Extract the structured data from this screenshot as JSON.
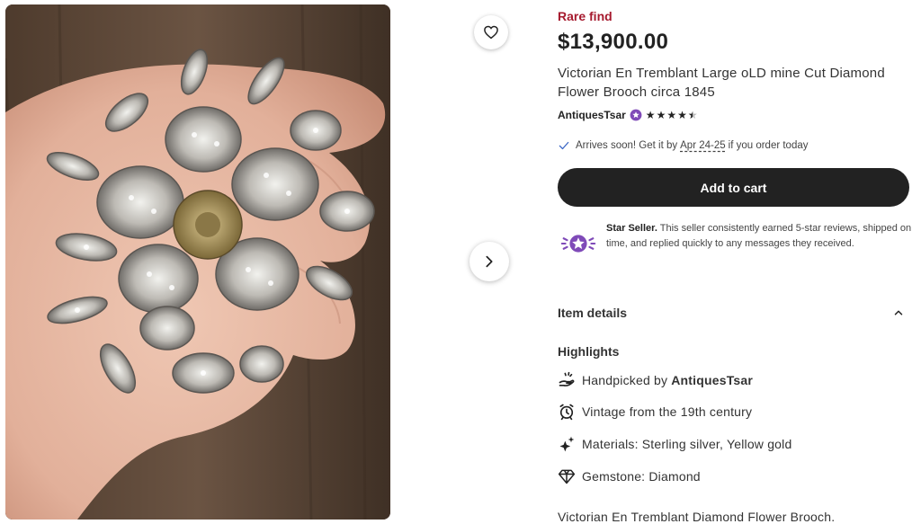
{
  "listing": {
    "rare_label": "Rare find",
    "price": "$13,900.00",
    "title": "Victorian En Tremblant Large oLD mine Cut Diamond Flower Brooch circa 1845",
    "seller": "AntiquesTsar",
    "rating": 4.5,
    "arrival": {
      "prefix": "Arrives soon! Get it by",
      "dates": "Apr 24-25",
      "suffix": "if you order today"
    },
    "add_to_cart": "Add to cart",
    "star_seller": {
      "title": "Star Seller.",
      "text": "This seller consistently earned 5-star reviews, shipped on time, and replied quickly to any messages they received."
    }
  },
  "details": {
    "header": "Item details",
    "highlights_title": "Highlights",
    "handpicked_prefix": "Handpicked by",
    "handpicked_name": "AntiquesTsar",
    "vintage": "Vintage from the 19th century",
    "materials": "Materials: Sterling silver, Yellow gold",
    "gemstone": "Gemstone: Diamond",
    "description_start": "Victorian En Tremblant Diamond Flower Brooch."
  },
  "colors": {
    "rare": "#a61a2e",
    "button": "#222222",
    "star_seller_purple": "#7f4ab8",
    "check": "#3b67c5"
  },
  "icons": [
    "heart-icon",
    "chevron-right-icon",
    "star-seller-badge-icon",
    "check-icon",
    "hand-icon",
    "alarm-clock-icon",
    "sparkle-icon",
    "diamond-icon",
    "chevron-up-icon"
  ]
}
